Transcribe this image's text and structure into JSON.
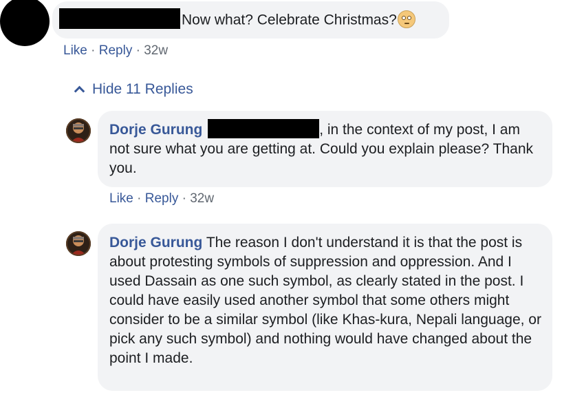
{
  "top_comment": {
    "text": "Now what? Celebrate Christmas?",
    "emoji": "rolling-eyes-emoji",
    "actions": {
      "like": "Like",
      "reply": "Reply",
      "sep": "·",
      "time": "32w"
    }
  },
  "replies_toggle": {
    "label": "Hide 11 Replies",
    "icon": "chevron-up-icon"
  },
  "replies": [
    {
      "author": "Dorje Gurung",
      "text": ", in the context of my post, I am not sure what you are getting at. Could you explain please? Thank you.",
      "actions": {
        "like": "Like",
        "reply": "Reply",
        "sep": "·",
        "time": "32w"
      }
    },
    {
      "author": "Dorje Gurung",
      "text": "The reason I don't understand it is that the post is about protesting symbols of suppression and oppression. And I used Dassain as one such symbol, as clearly stated in the post. I could have easily used another symbol that some others might consider to be a similar symbol (like Khas-kura, Nepali language, or pick any such symbol) and nothing would have changed about the point I made."
    }
  ],
  "colors": {
    "link": "#385898",
    "bubble": "#f2f3f5",
    "meta_gray": "#606770",
    "text": "#1c1e21"
  }
}
